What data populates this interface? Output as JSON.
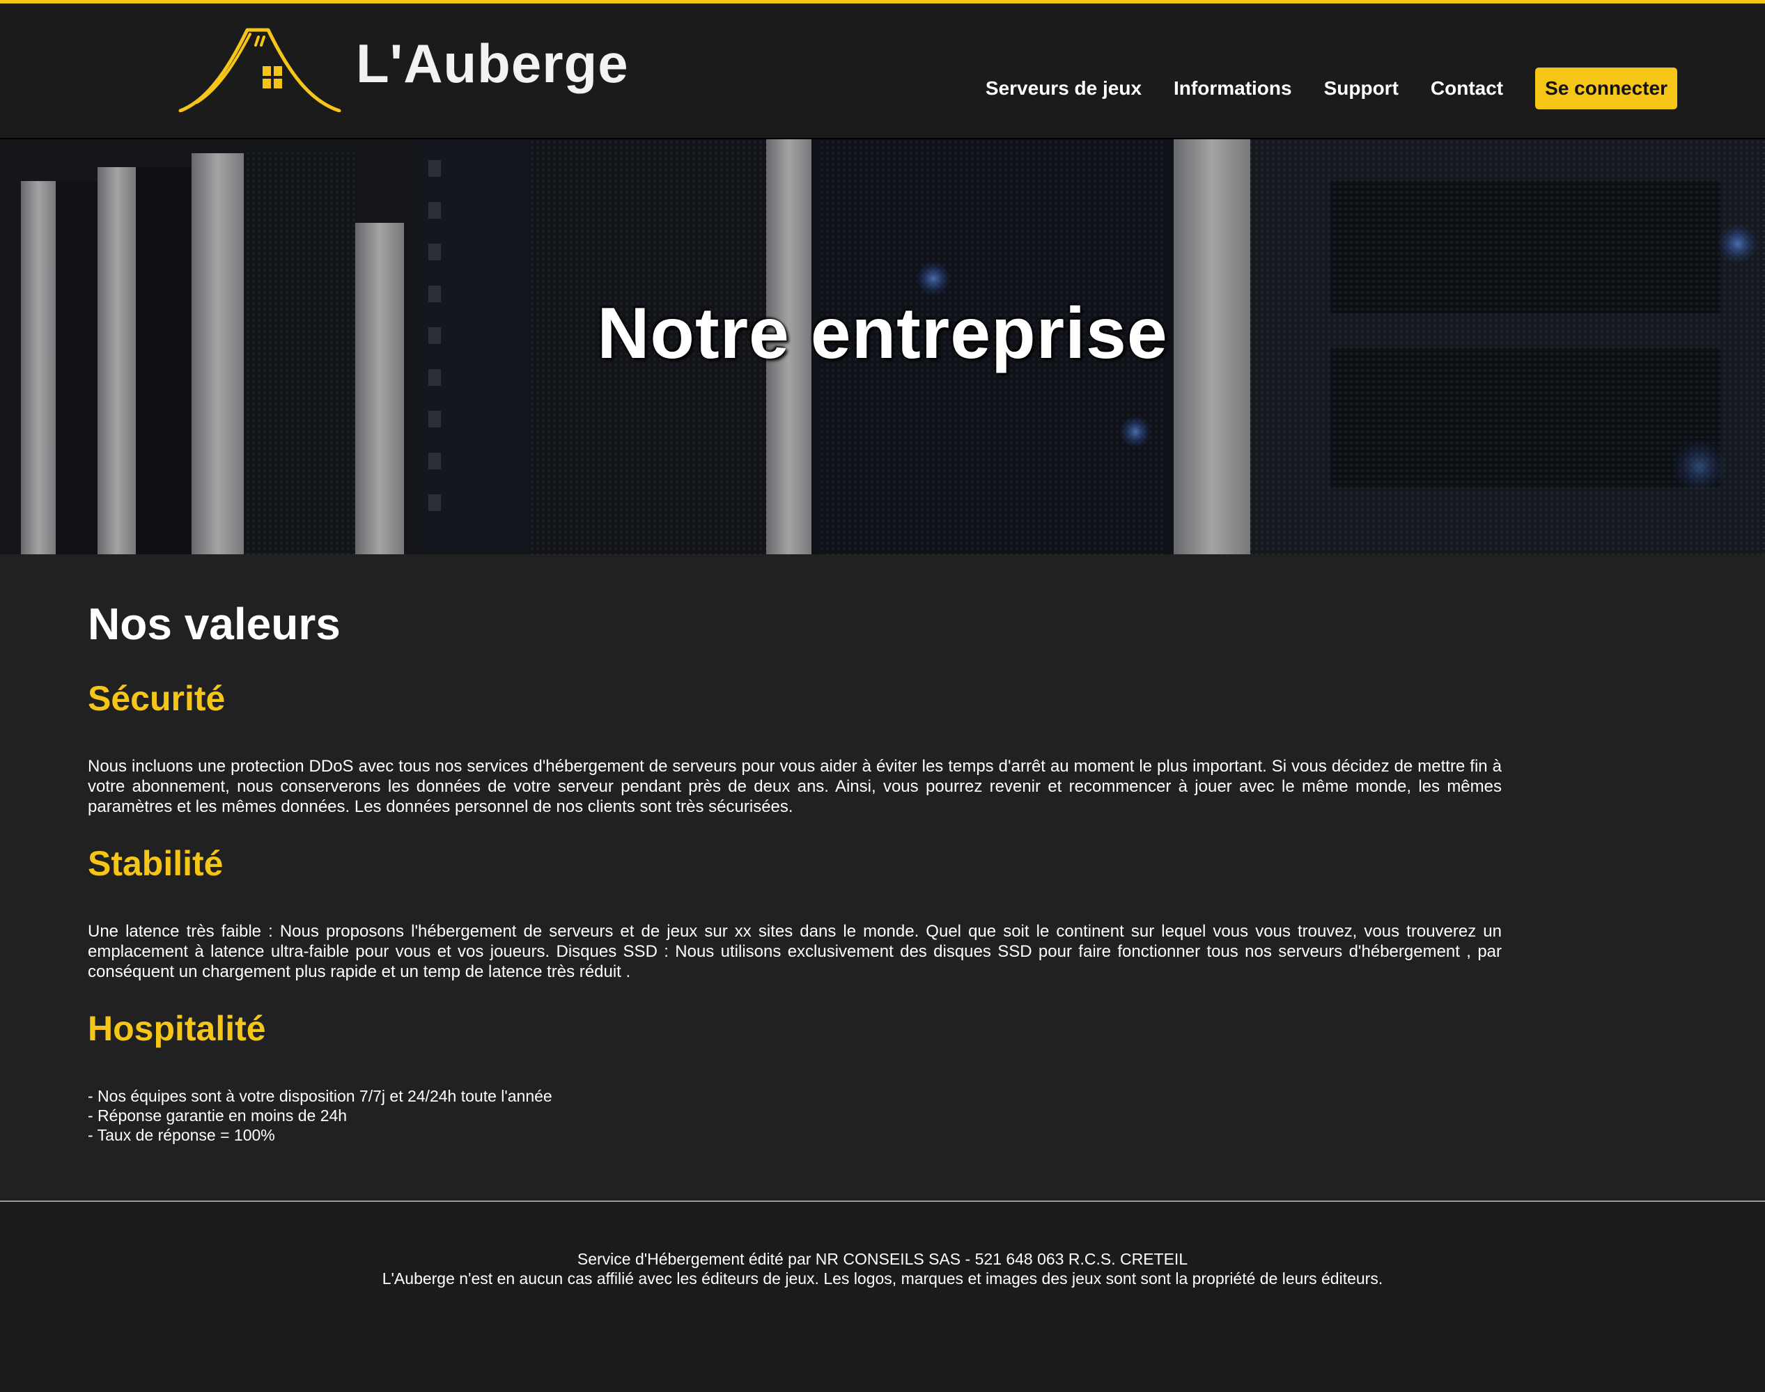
{
  "brand": {
    "name": "L'Auberge",
    "logo_icon": "roof-house-icon",
    "accent": "#f5c518"
  },
  "nav": {
    "items": [
      {
        "label": "Serveurs de jeux"
      },
      {
        "label": "Informations"
      },
      {
        "label": "Support"
      },
      {
        "label": "Contact"
      }
    ],
    "login_label": "Se connecter"
  },
  "hero": {
    "title": "Notre entreprise"
  },
  "main": {
    "heading": "Nos valeurs",
    "sections": [
      {
        "title": "Sécurité",
        "text": "Nous incluons une protection DDoS avec tous nos services d'hébergement de serveurs pour vous aider à éviter les temps d'arrêt au moment le plus important. Si vous décidez de mettre fin à votre abonnement, nous conserverons les données de votre serveur pendant près de deux ans. Ainsi, vous pourrez revenir et recommencer à jouer avec le même monde, les mêmes paramètres et les mêmes données. Les données personnel de nos clients sont très sécurisées."
      },
      {
        "title": "Stabilité",
        "text": "Une latence très faible : Nous proposons l'hébergement de serveurs et de jeux sur xx sites dans le monde. Quel que soit le continent sur lequel vous vous trouvez, vous trouverez un emplacement à latence ultra-faible pour vous et vos joueurs. Disques SSD : Nous utilisons exclusivement des disques SSD pour faire fonctionner tous nos serveurs d'hébergement , par conséquent un chargement plus rapide et un temp de latence très réduit ."
      },
      {
        "title": "Hospitalité",
        "items": [
          "- Nos équipes sont à votre disposition 7/7j et 24/24h toute l'année",
          "- Réponse garantie en moins de 24h",
          "- Taux de réponse = 100%"
        ]
      }
    ]
  },
  "footer": {
    "line1": "Service d'Hébergement édité par NR CONSEILS SAS - 521 648 063 R.C.S. CRETEIL",
    "line2": "L'Auberge n'est en aucun cas affilié avec les éditeurs de jeux. Les logos, marques et images des jeux sont sont la propriété de leurs éditeurs."
  }
}
